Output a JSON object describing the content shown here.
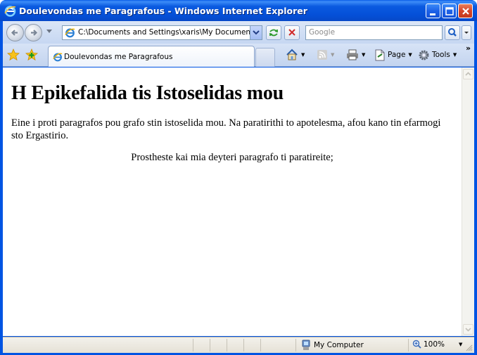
{
  "window": {
    "title": "Doulevondas me Paragrafous - Windows Internet Explorer"
  },
  "address_bar": {
    "url": "C:\\Documents and Settings\\xaris\\My Documents\\Te",
    "search_placeholder": "Google"
  },
  "tabs": [
    {
      "label": "Doulevondas me Paragrafous"
    }
  ],
  "command_bar": {
    "page_label": "Page",
    "tools_label": "Tools"
  },
  "page": {
    "heading": "H Epikefalida tis Istoselidas mou",
    "paragraph1": "Eine i proti paragrafos pou grafo stin istoselida mou. Na paratirithi to apotelesma, afou kano tin efarmogi sto Ergastirio.",
    "paragraph2": "Prostheste kai mia deyteri paragrafo ti paratireite;"
  },
  "status_bar": {
    "zone": "My Computer",
    "zoom": "100%"
  },
  "icons": [
    "ie-icon",
    "minimize-icon",
    "maximize-icon",
    "close-icon",
    "back-arrow-icon",
    "forward-arrow-icon",
    "refresh-icon",
    "stop-icon",
    "search-icon",
    "favorites-star-icon",
    "add-favorites-icon",
    "home-icon",
    "feeds-icon",
    "print-icon",
    "page-icon",
    "tools-gear-icon",
    "computer-icon",
    "zoom-icon"
  ]
}
